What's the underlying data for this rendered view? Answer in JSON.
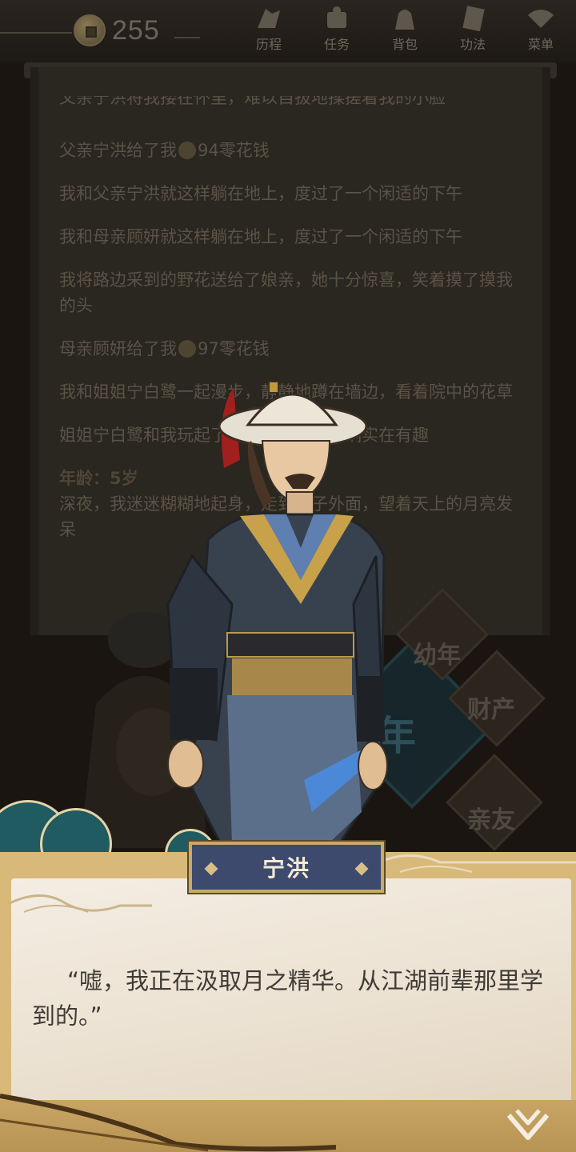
{
  "top_bar": {
    "coin_count": "255",
    "nav": [
      {
        "label": "历程",
        "icon": "journey-icon"
      },
      {
        "label": "任务",
        "icon": "task-icon"
      },
      {
        "label": "背包",
        "icon": "bag-icon"
      },
      {
        "label": "功法",
        "icon": "skill-book-icon"
      },
      {
        "label": "菜单",
        "icon": "fan-menu-icon"
      }
    ]
  },
  "story": {
    "clipped_line": "父亲宁洪将我搂在怀里，难以自拔地揉搓着我的小脸",
    "entries": [
      {
        "pre": "父亲宁洪给了我",
        "post": "94零花钱",
        "has_coin": true
      },
      {
        "text": "我和父亲宁洪就这样躺在地上，度过了一个闲适的下午"
      },
      {
        "text": "我和母亲顾妍就这样躺在地上，度过了一个闲适的下午"
      },
      {
        "text": "我将路边采到的野花送给了娘亲，她十分惊喜，笑着摸了摸我的头"
      },
      {
        "pre": "母亲顾妍给了我",
        "post": "97零花钱",
        "has_coin": true
      },
      {
        "text": "我和姐姐宁白鹭一起漫步，静静地蹲在墙边，看着院中的花草"
      },
      {
        "text": "姐姐宁白鹭和我玩起了拨浪鼓，一拨一响实在有趣"
      }
    ],
    "age_label": "年龄：5岁",
    "age_entry": "深夜，我迷迷糊糊地起身，走到院子外面，望着天上的月亮发呆"
  },
  "side_badges": {
    "childhood": "幼年",
    "year": "年",
    "property": "财产",
    "relatives": "亲友"
  },
  "dialogue": {
    "speaker": "宁洪",
    "text": "“嘘，我正在汲取月之精华。从江湖前辈那里学到的。”"
  },
  "colors": {
    "name_plate": "#3d4a6e",
    "dialog_frame": "#d8b979",
    "teal_cloud": "#1f5b60"
  }
}
